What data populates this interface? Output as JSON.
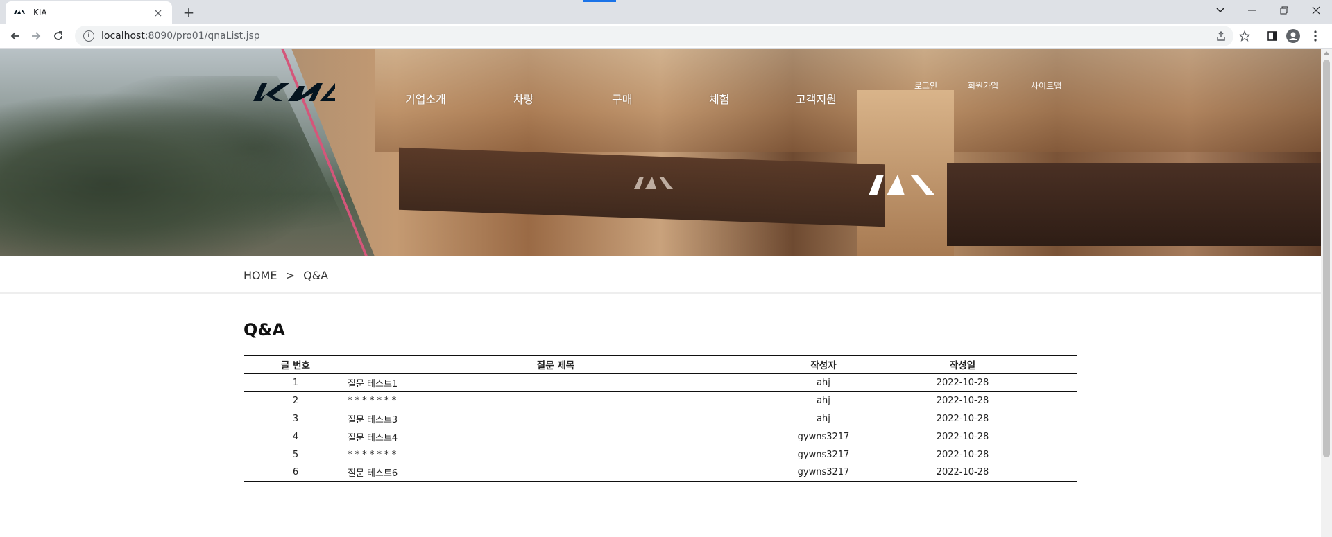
{
  "browser": {
    "tab_title": "KIA",
    "url_host": "localhost",
    "url_rest": ":8090/pro01/qnaList.jsp"
  },
  "header": {
    "logo_text": "KIA",
    "nav": [
      "기업소개",
      "차량",
      "구매",
      "체험",
      "고객지원"
    ],
    "util": [
      "로그인",
      "회원가입",
      "사이트맵"
    ]
  },
  "breadcrumb": {
    "home": "HOME",
    "separator": ">",
    "current": "Q&A"
  },
  "page": {
    "title": "Q&A"
  },
  "table": {
    "columns": [
      "글 번호",
      "질문 제목",
      "작성자",
      "작성일"
    ],
    "rows": [
      {
        "num": "1",
        "title": "질문 테스트1",
        "writer": "ahj",
        "date": "2022-10-28"
      },
      {
        "num": "2",
        "title": "* * * * * * *",
        "writer": "ahj",
        "date": "2022-10-28"
      },
      {
        "num": "3",
        "title": "질문 테스트3",
        "writer": "ahj",
        "date": "2022-10-28"
      },
      {
        "num": "4",
        "title": "질문 테스트4",
        "writer": "gywns3217",
        "date": "2022-10-28"
      },
      {
        "num": "5",
        "title": "* * * * * * *",
        "writer": "gywns3217",
        "date": "2022-10-28"
      },
      {
        "num": "6",
        "title": "질문 테스트6",
        "writer": "gywns3217",
        "date": "2022-10-28"
      }
    ]
  },
  "icons": {
    "back": "arrow-left-icon",
    "forward": "arrow-right-icon",
    "reload": "reload-icon",
    "info": "info-icon",
    "share": "share-icon",
    "bookmark": "star-icon",
    "sidepanel": "side-panel-icon",
    "profile": "profile-icon",
    "menu": "kebab-menu-icon"
  }
}
